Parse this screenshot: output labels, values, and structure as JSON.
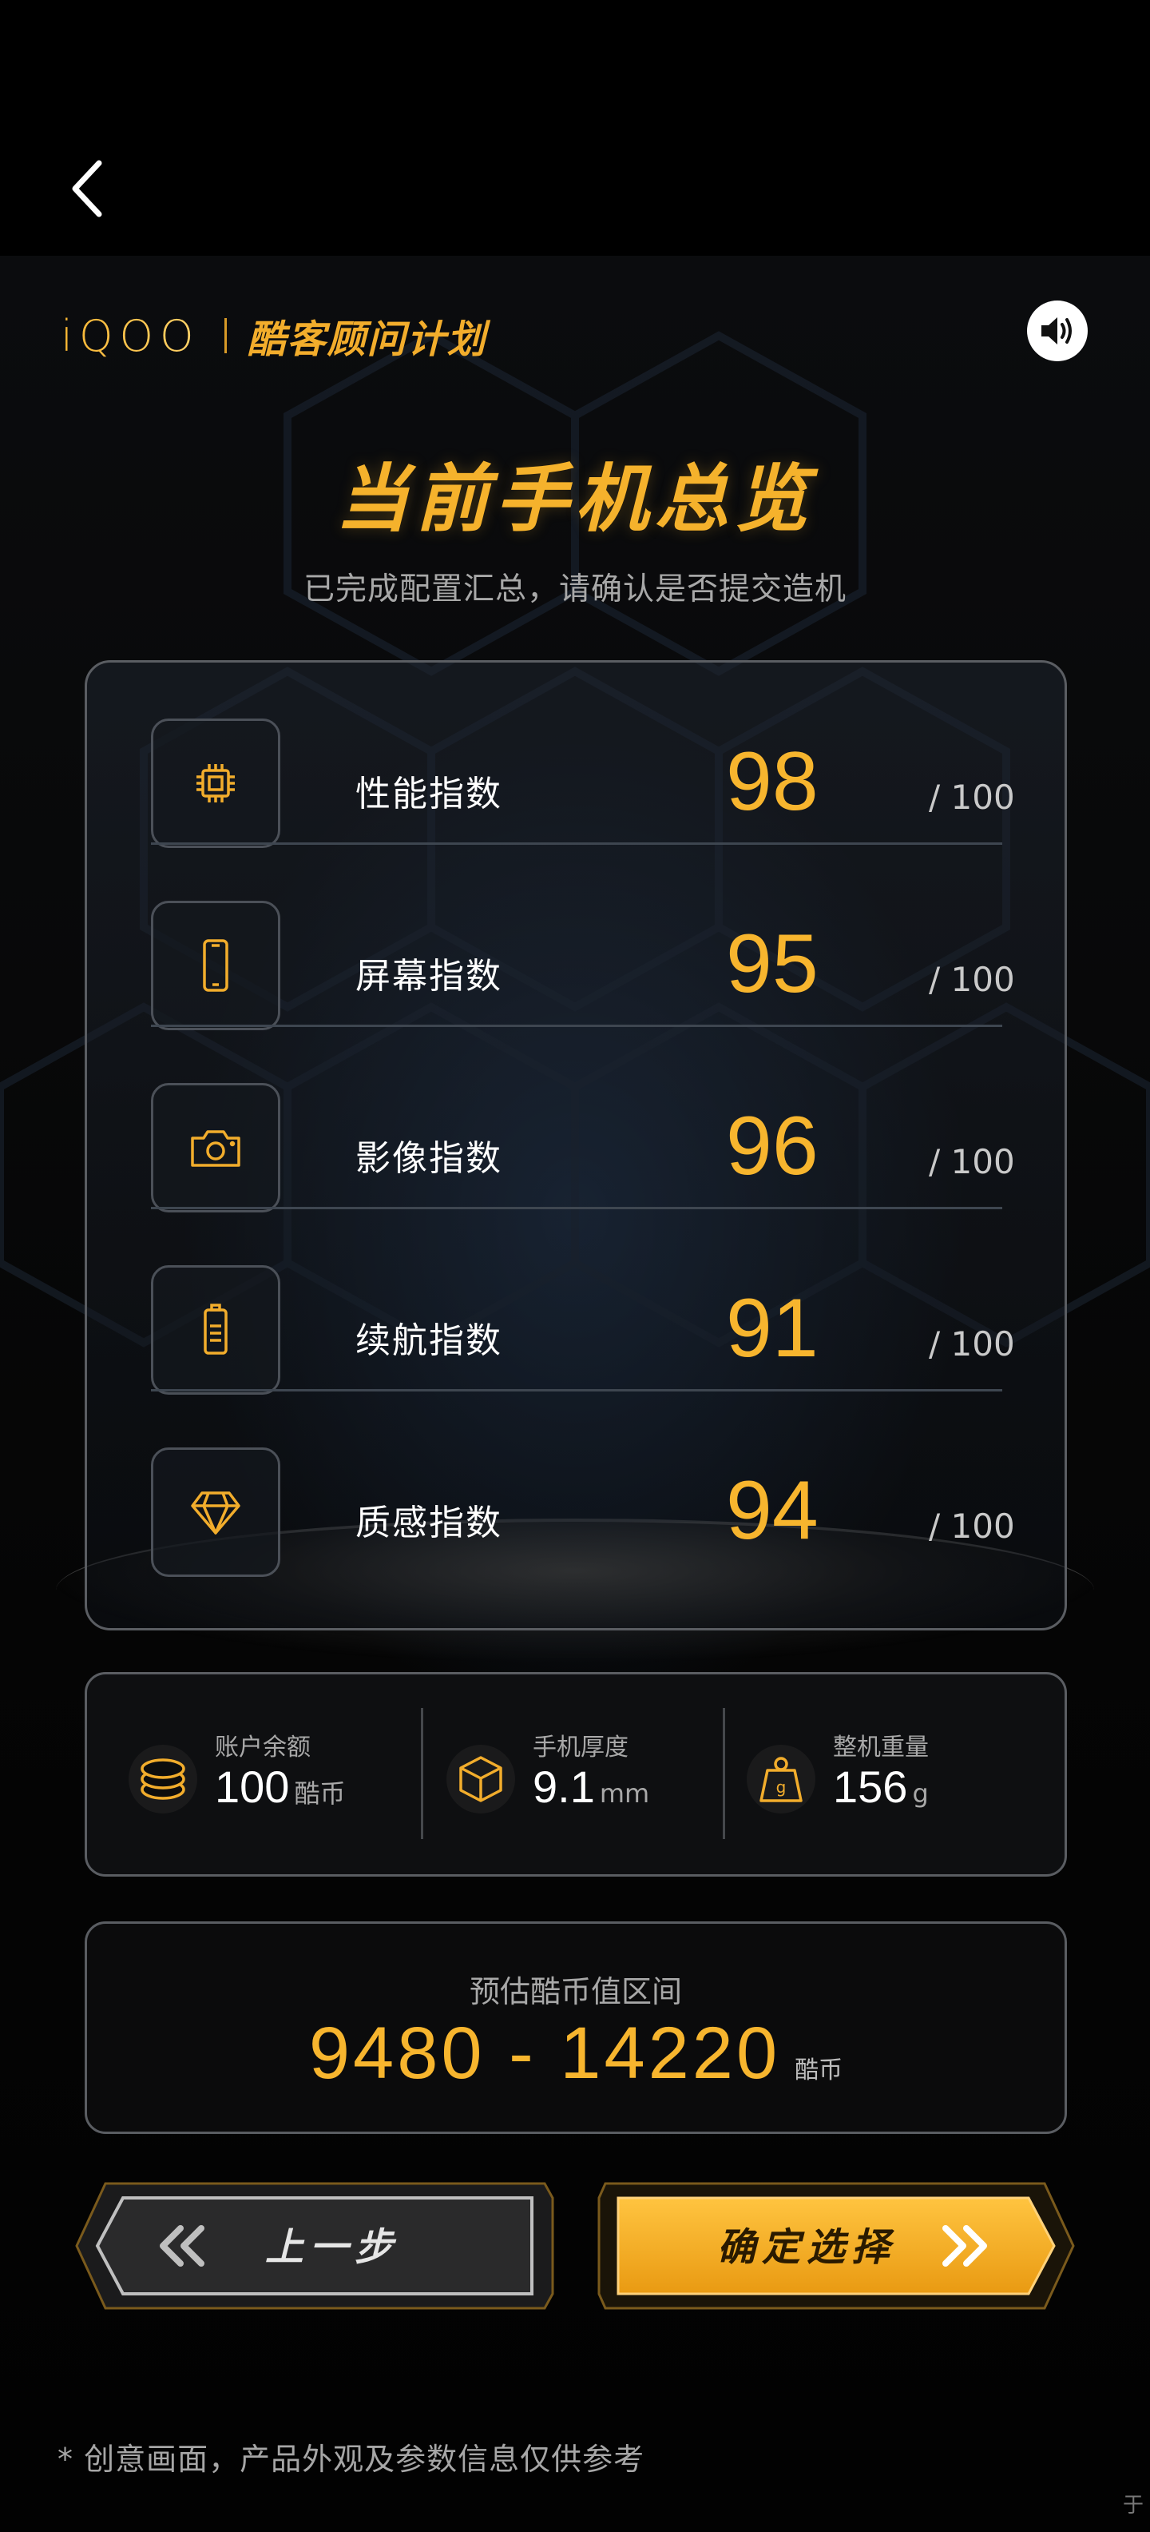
{
  "header": {
    "back_icon": "chevron-left-icon",
    "brand_logo": "iQOO",
    "brand_name": "酷客顾问计划",
    "sound_icon": "speaker-icon"
  },
  "overview": {
    "title": "当前手机总览",
    "subtitle": "已完成配置汇总，请确认是否提交造机"
  },
  "scores": [
    {
      "icon": "chip-icon",
      "label": "性能指数",
      "score": "98",
      "max": "/ 100"
    },
    {
      "icon": "phone-icon",
      "label": "屏幕指数",
      "score": "95",
      "max": "/ 100"
    },
    {
      "icon": "camera-icon",
      "label": "影像指数",
      "score": "96",
      "max": "/ 100"
    },
    {
      "icon": "battery-icon",
      "label": "续航指数",
      "score": "91",
      "max": "/ 100"
    },
    {
      "icon": "diamond-icon",
      "label": "质感指数",
      "score": "94",
      "max": "/ 100"
    }
  ],
  "info": [
    {
      "icon": "coins-icon",
      "label": "账户余额",
      "value": "100",
      "unit": "酷币"
    },
    {
      "icon": "cube-icon",
      "label": "手机厚度",
      "value": "9.1",
      "unit": "mm"
    },
    {
      "icon": "weight-icon",
      "label": "整机重量",
      "value": "156",
      "unit": "g"
    }
  ],
  "estimate": {
    "label": "预估酷币值区间",
    "value": "9480 - 14220",
    "unit": "酷币"
  },
  "buttons": {
    "prev_label": "上一步",
    "next_label": "确定选择"
  },
  "footnote": "* 创意画面，产品外观及参数信息仅供参考",
  "corner_mark": "于",
  "colors": {
    "accent": "#F7B52E",
    "background": "#000000",
    "card_border": "#5A5D62"
  }
}
